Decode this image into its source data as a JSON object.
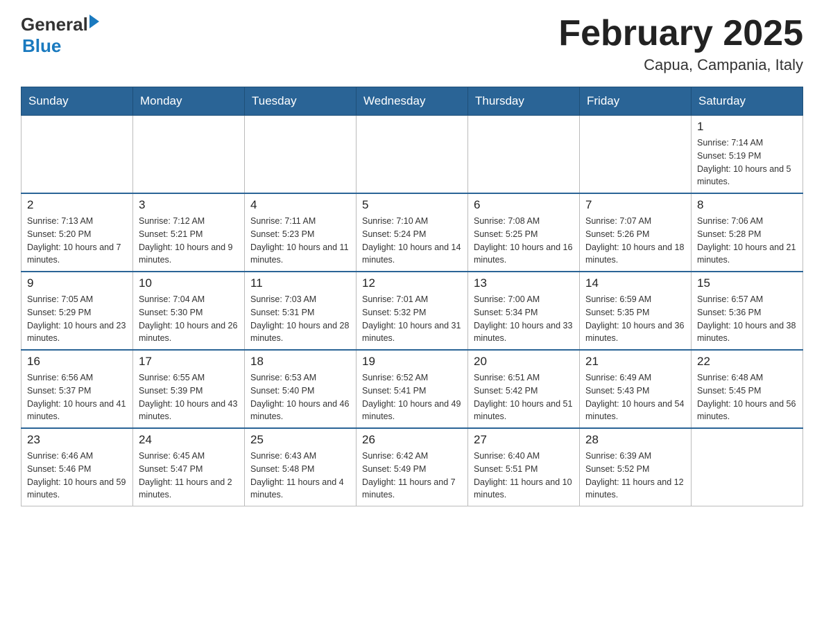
{
  "header": {
    "logo": {
      "general": "General",
      "arrow": "▶",
      "blue": "Blue"
    },
    "title": "February 2025",
    "subtitle": "Capua, Campania, Italy"
  },
  "weekdays": [
    "Sunday",
    "Monday",
    "Tuesday",
    "Wednesday",
    "Thursday",
    "Friday",
    "Saturday"
  ],
  "weeks": [
    [
      {
        "day": "",
        "info": ""
      },
      {
        "day": "",
        "info": ""
      },
      {
        "day": "",
        "info": ""
      },
      {
        "day": "",
        "info": ""
      },
      {
        "day": "",
        "info": ""
      },
      {
        "day": "",
        "info": ""
      },
      {
        "day": "1",
        "info": "Sunrise: 7:14 AM\nSunset: 5:19 PM\nDaylight: 10 hours and 5 minutes."
      }
    ],
    [
      {
        "day": "2",
        "info": "Sunrise: 7:13 AM\nSunset: 5:20 PM\nDaylight: 10 hours and 7 minutes."
      },
      {
        "day": "3",
        "info": "Sunrise: 7:12 AM\nSunset: 5:21 PM\nDaylight: 10 hours and 9 minutes."
      },
      {
        "day": "4",
        "info": "Sunrise: 7:11 AM\nSunset: 5:23 PM\nDaylight: 10 hours and 11 minutes."
      },
      {
        "day": "5",
        "info": "Sunrise: 7:10 AM\nSunset: 5:24 PM\nDaylight: 10 hours and 14 minutes."
      },
      {
        "day": "6",
        "info": "Sunrise: 7:08 AM\nSunset: 5:25 PM\nDaylight: 10 hours and 16 minutes."
      },
      {
        "day": "7",
        "info": "Sunrise: 7:07 AM\nSunset: 5:26 PM\nDaylight: 10 hours and 18 minutes."
      },
      {
        "day": "8",
        "info": "Sunrise: 7:06 AM\nSunset: 5:28 PM\nDaylight: 10 hours and 21 minutes."
      }
    ],
    [
      {
        "day": "9",
        "info": "Sunrise: 7:05 AM\nSunset: 5:29 PM\nDaylight: 10 hours and 23 minutes."
      },
      {
        "day": "10",
        "info": "Sunrise: 7:04 AM\nSunset: 5:30 PM\nDaylight: 10 hours and 26 minutes."
      },
      {
        "day": "11",
        "info": "Sunrise: 7:03 AM\nSunset: 5:31 PM\nDaylight: 10 hours and 28 minutes."
      },
      {
        "day": "12",
        "info": "Sunrise: 7:01 AM\nSunset: 5:32 PM\nDaylight: 10 hours and 31 minutes."
      },
      {
        "day": "13",
        "info": "Sunrise: 7:00 AM\nSunset: 5:34 PM\nDaylight: 10 hours and 33 minutes."
      },
      {
        "day": "14",
        "info": "Sunrise: 6:59 AM\nSunset: 5:35 PM\nDaylight: 10 hours and 36 minutes."
      },
      {
        "day": "15",
        "info": "Sunrise: 6:57 AM\nSunset: 5:36 PM\nDaylight: 10 hours and 38 minutes."
      }
    ],
    [
      {
        "day": "16",
        "info": "Sunrise: 6:56 AM\nSunset: 5:37 PM\nDaylight: 10 hours and 41 minutes."
      },
      {
        "day": "17",
        "info": "Sunrise: 6:55 AM\nSunset: 5:39 PM\nDaylight: 10 hours and 43 minutes."
      },
      {
        "day": "18",
        "info": "Sunrise: 6:53 AM\nSunset: 5:40 PM\nDaylight: 10 hours and 46 minutes."
      },
      {
        "day": "19",
        "info": "Sunrise: 6:52 AM\nSunset: 5:41 PM\nDaylight: 10 hours and 49 minutes."
      },
      {
        "day": "20",
        "info": "Sunrise: 6:51 AM\nSunset: 5:42 PM\nDaylight: 10 hours and 51 minutes."
      },
      {
        "day": "21",
        "info": "Sunrise: 6:49 AM\nSunset: 5:43 PM\nDaylight: 10 hours and 54 minutes."
      },
      {
        "day": "22",
        "info": "Sunrise: 6:48 AM\nSunset: 5:45 PM\nDaylight: 10 hours and 56 minutes."
      }
    ],
    [
      {
        "day": "23",
        "info": "Sunrise: 6:46 AM\nSunset: 5:46 PM\nDaylight: 10 hours and 59 minutes."
      },
      {
        "day": "24",
        "info": "Sunrise: 6:45 AM\nSunset: 5:47 PM\nDaylight: 11 hours and 2 minutes."
      },
      {
        "day": "25",
        "info": "Sunrise: 6:43 AM\nSunset: 5:48 PM\nDaylight: 11 hours and 4 minutes."
      },
      {
        "day": "26",
        "info": "Sunrise: 6:42 AM\nSunset: 5:49 PM\nDaylight: 11 hours and 7 minutes."
      },
      {
        "day": "27",
        "info": "Sunrise: 6:40 AM\nSunset: 5:51 PM\nDaylight: 11 hours and 10 minutes."
      },
      {
        "day": "28",
        "info": "Sunrise: 6:39 AM\nSunset: 5:52 PM\nDaylight: 11 hours and 12 minutes."
      },
      {
        "day": "",
        "info": ""
      }
    ]
  ]
}
